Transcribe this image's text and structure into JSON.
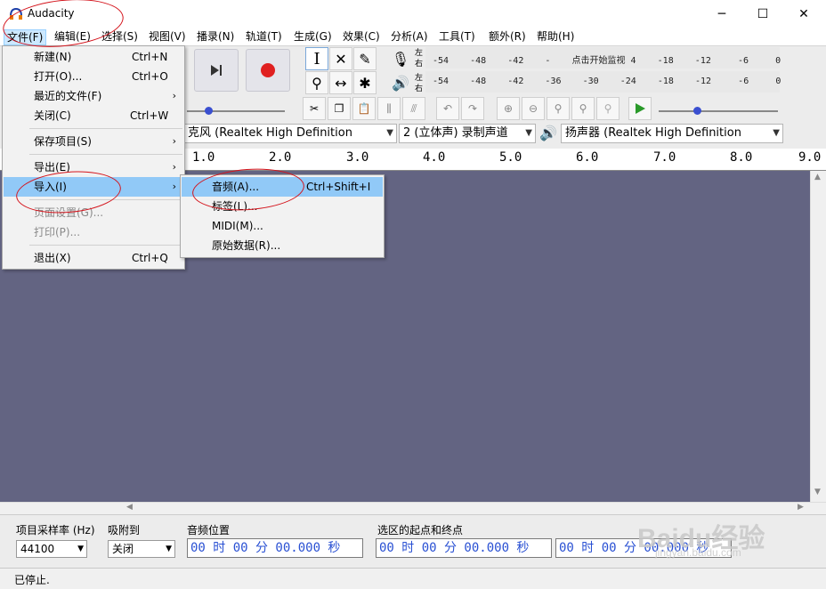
{
  "window": {
    "title": "Audacity",
    "minimize": "─",
    "maximize": "☐",
    "close": "✕"
  },
  "menubar": [
    "文件(F)",
    "编辑(E)",
    "选择(S)",
    "视图(V)",
    "播录(N)",
    "轨道(T)",
    "生成(G)",
    "效果(C)",
    "分析(A)",
    "工具(T)",
    "额外(R)",
    "帮助(H)"
  ],
  "file_menu": [
    {
      "label": "新建(N)",
      "shortcut": "Ctrl+N"
    },
    {
      "label": "打开(O)...",
      "shortcut": "Ctrl+O"
    },
    {
      "label": "最近的文件(F)",
      "submenu": true
    },
    {
      "label": "关闭(C)",
      "shortcut": "Ctrl+W"
    },
    {
      "label": "保存项目(S)",
      "submenu": true
    },
    {
      "label": "导出(E)",
      "submenu": true
    },
    {
      "label": "导入(I)",
      "submenu": true,
      "highlighted": true
    },
    {
      "label": "页面设置(G)...",
      "disabled": true
    },
    {
      "label": "打印(P)...",
      "disabled": true
    },
    {
      "label": "退出(X)",
      "shortcut": "Ctrl+Q"
    }
  ],
  "import_submenu": [
    {
      "label": "音频(A)...",
      "shortcut": "Ctrl+Shift+I",
      "highlighted": true
    },
    {
      "label": "标签(L)..."
    },
    {
      "label": "MIDI(M)..."
    },
    {
      "label": "原始数据(R)..."
    }
  ],
  "meters": {
    "record_lr": [
      "左",
      "右"
    ],
    "play_lr": [
      "左",
      "右"
    ],
    "record_scale": "-54    -48    -42    -    点击开始监视 4    -18    -12     -6     0",
    "play_scale": "-54    -48    -42    -36    -30    -24    -18    -12     -6     0"
  },
  "devices": {
    "mic": "克风 (Realtek High Definition",
    "channels": "2 (立体声) 录制声道",
    "speaker": "扬声器 (Realtek High Definition"
  },
  "ruler": [
    "1.0",
    "2.0",
    "3.0",
    "4.0",
    "5.0",
    "6.0",
    "7.0",
    "8.0",
    "9.0"
  ],
  "selection_toolbar": {
    "rate_label": "项目采样率 (Hz)",
    "rate_value": "44100",
    "snap_label": "吸附到",
    "snap_value": "关闭",
    "audio_pos_label": "音频位置",
    "audio_pos_value": "00 时 00 分 00.000 秒",
    "sel_label": "选区的起点和终点",
    "sel_start": "00 时 00 分 00.000 秒",
    "sel_end": "00 时 00 分 00.000 秒"
  },
  "status": "已停止.",
  "watermark": {
    "logo": "Baidu经验",
    "url": "jingyan.baidu.com"
  },
  "colors": {
    "track_bg": "#636482",
    "menu_highlight": "#91c9f7",
    "record": "#e02020",
    "play": "#2a9a2a",
    "annotation": "#d4141c"
  }
}
